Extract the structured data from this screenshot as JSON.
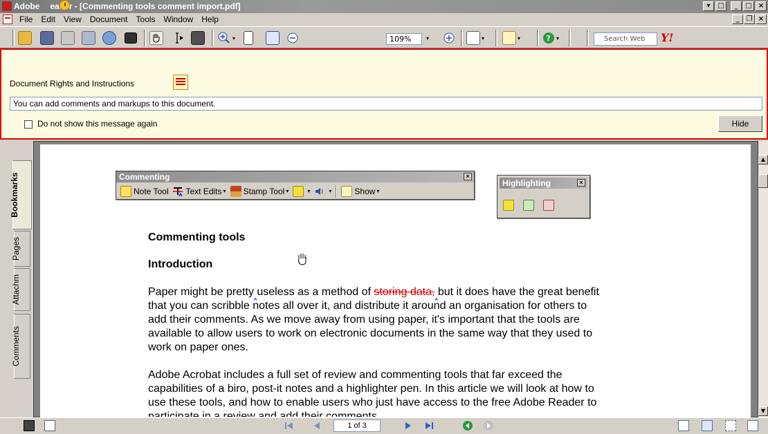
{
  "window": {
    "app_name_prefix": "Adobe",
    "title_rest": "eader - [Commenting tools comment import.pdf]",
    "controls": [
      "▾",
      "_",
      "□",
      "×"
    ]
  },
  "menu": {
    "items": [
      "File",
      "Edit",
      "View",
      "Document",
      "Tools",
      "Window",
      "Help"
    ],
    "mdi_controls": [
      "_",
      "❐",
      "×"
    ]
  },
  "toolbar": {
    "zoom": "109%",
    "search_placeholder": "Search Web",
    "yahoo_label": "Y!"
  },
  "banner": {
    "title": "Document Rights and Instructions",
    "message": "You can add comments and markups to this document.",
    "checkbox_label": "Do not show this message again",
    "hide_label": "Hide"
  },
  "nav_tabs": [
    "Bookmarks",
    "Pages",
    "Attachm",
    "Comments"
  ],
  "commenting_panel": {
    "title": "Commenting",
    "note_tool": "Note Tool",
    "text_edits": "Text Edits",
    "stamp_tool": "Stamp Tool",
    "show": "Show"
  },
  "highlighting_panel": {
    "title": "Highlighting"
  },
  "document": {
    "heading1": "Commenting tools",
    "heading2": "Introduction",
    "p1_a": "Paper might be pretty",
    "p1_b": "useless as a method of",
    "p1_strike": "storing data,",
    "p1_c": "but it does have the great benefit",
    "p1_line2": "that you can scribble notes all over it, and distribute it around an organisation for others to",
    "p1_line3": "add their comments. As we move away from using paper, it's important that the tools are",
    "p1_line4": "available to allow users to work on electronic documents in the same way that they used to",
    "p1_line5": "work on paper ones.",
    "p2_line1": "Adobe Acrobat includes a full set of review and commenting tools that far exceed the",
    "p2_line2": "capabilities of a biro, post-it notes and a highlighter pen. In this article we will look at how to",
    "p2_line3": "use these tools, and how to enable users who just have access to the free Adobe Reader to",
    "p2_line4": "participate in a review and add their comments."
  },
  "status": {
    "page_indicator": "1 of 3"
  },
  "colors": {
    "banner_border": "#e00000",
    "banner_bg": "#fcfae0",
    "strike": "#d00000",
    "insert_caret": "#1030e0"
  }
}
